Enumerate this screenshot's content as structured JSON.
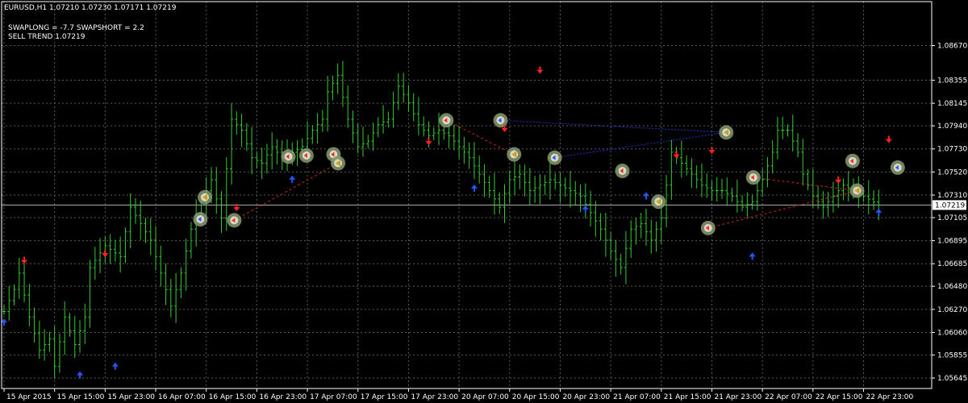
{
  "header": {
    "symbol_line": "EURUSD,H1  1.07210 1.07230 1.07171 1.07219",
    "swap_line": "SWAPLONG = -7.7   SWAPSHORT = 2.2",
    "trend_line": "SELL TREND 1.07219"
  },
  "colors": {
    "background": "#000000",
    "grid": "#5a5a5a",
    "bars": "#33cc33",
    "axis_text": "#ffffff",
    "up_arrow": "#2255ff",
    "down_arrow": "#ff2222",
    "sell_line": "#cc2222",
    "buy_line": "#2233cc",
    "price_line": "#b0b0b0",
    "marker_ring": "#8a9a70"
  },
  "chart_data": {
    "type": "ohlc",
    "symbol": "EURUSD",
    "timeframe": "H1",
    "grid": true,
    "ylim": [
      1.0555,
      1.0907
    ],
    "xlim": [
      0,
      183
    ],
    "y_ticks": [
      "1.08670",
      "1.08355",
      "1.08145",
      "1.07940",
      "1.07730",
      "1.07520",
      "1.07310",
      "1.07105",
      "1.06895",
      "1.06685",
      "1.06480",
      "1.06270",
      "1.06060",
      "1.05855",
      "1.05645"
    ],
    "x_ticks": [
      {
        "x": 0,
        "label": "15 Apr 2015"
      },
      {
        "x": 10,
        "label": "15 Apr 15:00"
      },
      {
        "x": 20,
        "label": "15 Apr 23:00"
      },
      {
        "x": 30,
        "label": "16 Apr 07:00"
      },
      {
        "x": 40,
        "label": "16 Apr 15:00"
      },
      {
        "x": 50,
        "label": "16 Apr 23:00"
      },
      {
        "x": 60,
        "label": "17 Apr 07:00"
      },
      {
        "x": 70,
        "label": "17 Apr 15:00"
      },
      {
        "x": 80,
        "label": "17 Apr 23:00"
      },
      {
        "x": 90,
        "label": "20 Apr 07:00"
      },
      {
        "x": 100,
        "label": "20 Apr 15:00"
      },
      {
        "x": 110,
        "label": "20 Apr 23:00"
      },
      {
        "x": 120,
        "label": "21 Apr 07:00"
      },
      {
        "x": 130,
        "label": "21 Apr 15:00"
      },
      {
        "x": 140,
        "label": "21 Apr 23:00"
      },
      {
        "x": 150,
        "label": "22 Apr 07:00"
      },
      {
        "x": 160,
        "label": "22 Apr 15:00"
      },
      {
        "x": 170,
        "label": "22 Apr 23:00"
      }
    ],
    "current_price": "1.07219",
    "anchors": [
      [
        0,
        1.0625
      ],
      [
        2,
        1.0645
      ],
      [
        3,
        1.066
      ],
      [
        5,
        1.062
      ],
      [
        7,
        1.059
      ],
      [
        9,
        1.06
      ],
      [
        10,
        1.0575
      ],
      [
        12,
        1.062
      ],
      [
        14,
        1.0595
      ],
      [
        16,
        1.062
      ],
      [
        17,
        1.0665
      ],
      [
        20,
        1.0685
      ],
      [
        23,
        1.0675
      ],
      [
        25,
        1.072
      ],
      [
        27,
        1.0705
      ],
      [
        29,
        1.069
      ],
      [
        31,
        1.066
      ],
      [
        33,
        1.063
      ],
      [
        35,
        1.066
      ],
      [
        37,
        1.07
      ],
      [
        39,
        1.0725
      ],
      [
        41,
        1.0745
      ],
      [
        43,
        1.071
      ],
      [
        45,
        1.08
      ],
      [
        47,
        1.079
      ],
      [
        49,
        1.0765
      ],
      [
        51,
        1.076
      ],
      [
        53,
        1.0775
      ],
      [
        55,
        1.0765
      ],
      [
        57,
        1.077
      ],
      [
        59,
        1.0775
      ],
      [
        61,
        1.079
      ],
      [
        63,
        1.08
      ],
      [
        64,
        1.0825
      ],
      [
        66,
        1.084
      ],
      [
        68,
        1.08
      ],
      [
        70,
        1.0775
      ],
      [
        72,
        1.078
      ],
      [
        74,
        1.0795
      ],
      [
        76,
        1.08
      ],
      [
        78,
        1.083
      ],
      [
        80,
        1.0815
      ],
      [
        82,
        1.0795
      ],
      [
        84,
        1.0785
      ],
      [
        86,
        1.079
      ],
      [
        88,
        1.0785
      ],
      [
        90,
        1.0775
      ],
      [
        92,
        1.0765
      ],
      [
        94,
        1.075
      ],
      [
        96,
        1.0735
      ],
      [
        98,
        1.072
      ],
      [
        100,
        1.0745
      ],
      [
        102,
        1.075
      ],
      [
        104,
        1.0735
      ],
      [
        106,
        1.074
      ],
      [
        108,
        1.0745
      ],
      [
        110,
        1.074
      ],
      [
        112,
        1.0735
      ],
      [
        114,
        1.073
      ],
      [
        116,
        1.0715
      ],
      [
        118,
        1.07
      ],
      [
        120,
        1.068
      ],
      [
        122,
        1.0665
      ],
      [
        124,
        1.07
      ],
      [
        126,
        1.0705
      ],
      [
        128,
        1.069
      ],
      [
        130,
        1.071
      ],
      [
        132,
        1.077
      ],
      [
        134,
        1.076
      ],
      [
        136,
        1.075
      ],
      [
        138,
        1.074
      ],
      [
        140,
        1.0735
      ],
      [
        142,
        1.0735
      ],
      [
        144,
        1.073
      ],
      [
        146,
        1.072
      ],
      [
        148,
        1.0725
      ],
      [
        150,
        1.0745
      ],
      [
        152,
        1.077
      ],
      [
        153,
        1.079
      ],
      [
        155,
        1.079
      ],
      [
        157,
        1.077
      ],
      [
        158,
        1.075
      ],
      [
        160,
        1.073
      ],
      [
        162,
        1.072
      ],
      [
        164,
        1.073
      ],
      [
        166,
        1.074
      ],
      [
        168,
        1.0735
      ],
      [
        170,
        1.073
      ],
      [
        173,
        1.0722
      ]
    ],
    "up_arrows": [
      [
        0,
        1.0615
      ],
      [
        15,
        1.0567
      ],
      [
        22,
        1.0575
      ],
      [
        57,
        1.0745
      ],
      [
        93,
        1.0737
      ],
      [
        115,
        1.0718
      ],
      [
        127,
        1.073
      ],
      [
        148,
        1.0675
      ],
      [
        173,
        1.0715
      ]
    ],
    "down_arrows": [
      [
        4,
        1.0672
      ],
      [
        20,
        1.0678
      ],
      [
        46,
        1.072
      ],
      [
        84,
        1.078
      ],
      [
        99,
        1.0792
      ],
      [
        106,
        1.0845
      ],
      [
        133,
        1.0768
      ],
      [
        140,
        1.0772
      ],
      [
        165,
        1.0745
      ],
      [
        175,
        1.0782
      ]
    ],
    "circle_markers": [
      {
        "x": 43.5,
        "y": 1.0709,
        "kind": "buy"
      },
      {
        "x": 44.5,
        "y": 1.0729,
        "kind": "sell-half"
      },
      {
        "x": 51,
        "y": 1.0708,
        "kind": "sell"
      },
      {
        "x": 63,
        "y": 1.0766,
        "kind": "sell"
      },
      {
        "x": 67,
        "y": 1.0767,
        "kind": "sell"
      },
      {
        "x": 73,
        "y": 1.0768,
        "kind": "sell"
      },
      {
        "x": 74,
        "y": 1.076,
        "kind": "sell-half"
      },
      {
        "x": 98,
        "y": 1.0799,
        "kind": "sell"
      },
      {
        "x": 110,
        "y": 1.0799,
        "kind": "buy"
      },
      {
        "x": 113,
        "y": 1.0768,
        "kind": "sell-half"
      },
      {
        "x": 122,
        "y": 1.0765,
        "kind": "buy"
      },
      {
        "x": 137,
        "y": 1.0753,
        "kind": "sell"
      },
      {
        "x": 145,
        "y": 1.0725,
        "kind": "sell-half"
      },
      {
        "x": 156,
        "y": 1.0701,
        "kind": "sell"
      },
      {
        "x": 160,
        "y": 1.0788,
        "kind": "sell-half"
      },
      {
        "x": 166,
        "y": 1.0747,
        "kind": "sell"
      },
      {
        "x": 188,
        "y": 1.0762,
        "kind": "sell"
      },
      {
        "x": 189,
        "y": 1.0735,
        "kind": "sell-half"
      },
      {
        "x": 198,
        "y": 1.0756,
        "kind": "buy"
      }
    ],
    "sell_lines": [
      [
        [
          51,
          1.0708
        ],
        [
          74,
          1.076
        ]
      ],
      [
        [
          98,
          1.0799
        ],
        [
          113,
          1.0768
        ]
      ],
      [
        [
          156,
          1.0701
        ],
        [
          189,
          1.0735
        ]
      ],
      [
        [
          166,
          1.0747
        ],
        [
          189,
          1.0735
        ]
      ]
    ],
    "buy_lines": [
      [
        [
          110,
          1.0799
        ],
        [
          160,
          1.0788
        ]
      ],
      [
        [
          122,
          1.0765
        ],
        [
          160,
          1.0788
        ]
      ]
    ]
  }
}
